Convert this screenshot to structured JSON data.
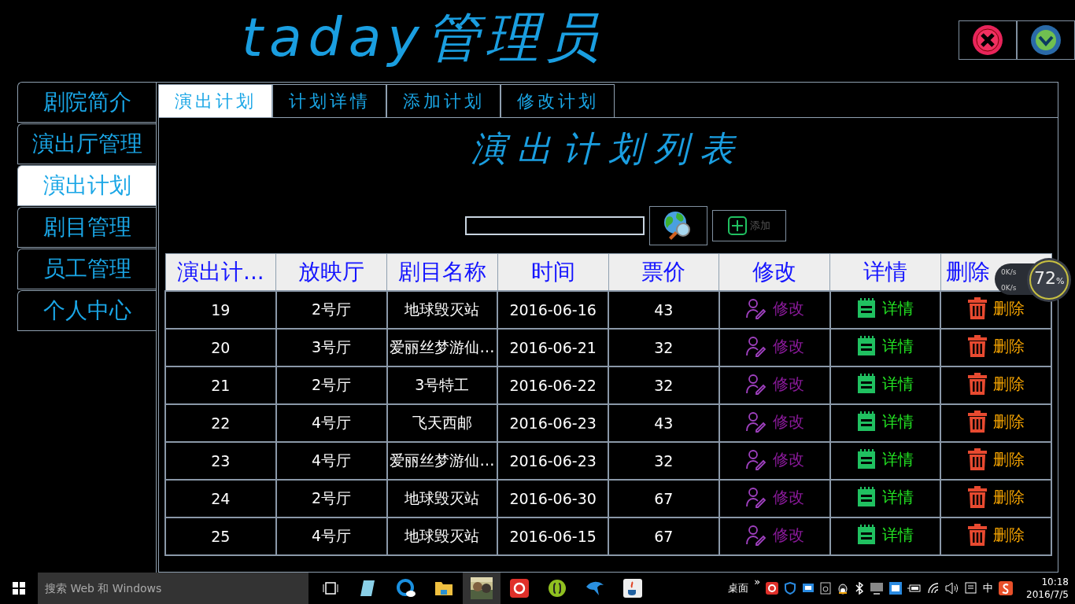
{
  "header": {
    "title": "taday管理员"
  },
  "sidebar": {
    "items": [
      {
        "label": "剧院简介",
        "selected": false
      },
      {
        "label": "演出厅管理",
        "selected": false
      },
      {
        "label": "演出计划",
        "selected": true
      },
      {
        "label": "剧目管理",
        "selected": false
      },
      {
        "label": "员工管理",
        "selected": false
      },
      {
        "label": "个人中心",
        "selected": false
      }
    ]
  },
  "tabs": [
    {
      "label": "演出计划",
      "selected": true
    },
    {
      "label": "计划详情",
      "selected": false
    },
    {
      "label": "添加计划",
      "selected": false
    },
    {
      "label": "修改计划",
      "selected": false
    }
  ],
  "page_title": "演出计划列表",
  "toolbar": {
    "add_button": {
      "label": "添加",
      "disabled": true
    }
  },
  "table": {
    "columns": [
      "演出计...",
      "放映厅",
      "剧目名称",
      "时间",
      "票价",
      "修改",
      "详情",
      "删除"
    ],
    "rows": [
      {
        "cells": [
          "19",
          "2号厅",
          "地球毁灭站",
          "2016-06-16",
          "43"
        ],
        "actions": [
          {
            "kind": "edit",
            "label": "修改"
          },
          {
            "kind": "detail",
            "label": "详情"
          },
          {
            "kind": "delete",
            "label": "删除"
          }
        ]
      },
      {
        "cells": [
          "20",
          "3号厅",
          "爱丽丝梦游仙…",
          "2016-06-21",
          "32"
        ],
        "actions": [
          {
            "kind": "edit",
            "label": "修改"
          },
          {
            "kind": "detail",
            "label": "详情"
          },
          {
            "kind": "delete",
            "label": "删除"
          }
        ]
      },
      {
        "cells": [
          "21",
          "2号厅",
          "3号特工",
          "2016-06-22",
          "32"
        ],
        "actions": [
          {
            "kind": "edit",
            "label": "修改"
          },
          {
            "kind": "detail",
            "label": "详情"
          },
          {
            "kind": "delete",
            "label": "删除"
          }
        ]
      },
      {
        "cells": [
          "22",
          "4号厅",
          "飞天西邮",
          "2016-06-23",
          "43"
        ],
        "actions": [
          {
            "kind": "edit",
            "label": "修改"
          },
          {
            "kind": "detail",
            "label": "详情"
          },
          {
            "kind": "delete",
            "label": "删除"
          }
        ]
      },
      {
        "cells": [
          "23",
          "4号厅",
          "爱丽丝梦游仙…",
          "2016-06-23",
          "32"
        ],
        "actions": [
          {
            "kind": "edit",
            "label": "修改"
          },
          {
            "kind": "detail",
            "label": "详情"
          },
          {
            "kind": "delete",
            "label": "删除"
          }
        ]
      },
      {
        "cells": [
          "24",
          "2号厅",
          "地球毁灭站",
          "2016-06-30",
          "67"
        ],
        "actions": [
          {
            "kind": "edit",
            "label": "修改"
          },
          {
            "kind": "detail",
            "label": "详情"
          },
          {
            "kind": "delete",
            "label": "删除"
          }
        ]
      },
      {
        "cells": [
          "25",
          "4号厅",
          "地球毁灭站",
          "2016-06-15",
          "67"
        ],
        "actions": [
          {
            "kind": "edit",
            "label": "修改"
          },
          {
            "kind": "detail",
            "label": "详情"
          },
          {
            "kind": "delete",
            "label": "删除"
          }
        ]
      }
    ]
  },
  "net_widget": {
    "upload": "0K/s",
    "download": "0K/s",
    "value": "72",
    "unit": "%"
  },
  "taskbar": {
    "search": {
      "placeholder": "搜索 Web 和 Windows"
    },
    "desktop_label": "桌面",
    "overflow": "»",
    "ime": "中",
    "time": "10:18",
    "date": "2016/7/5"
  }
}
